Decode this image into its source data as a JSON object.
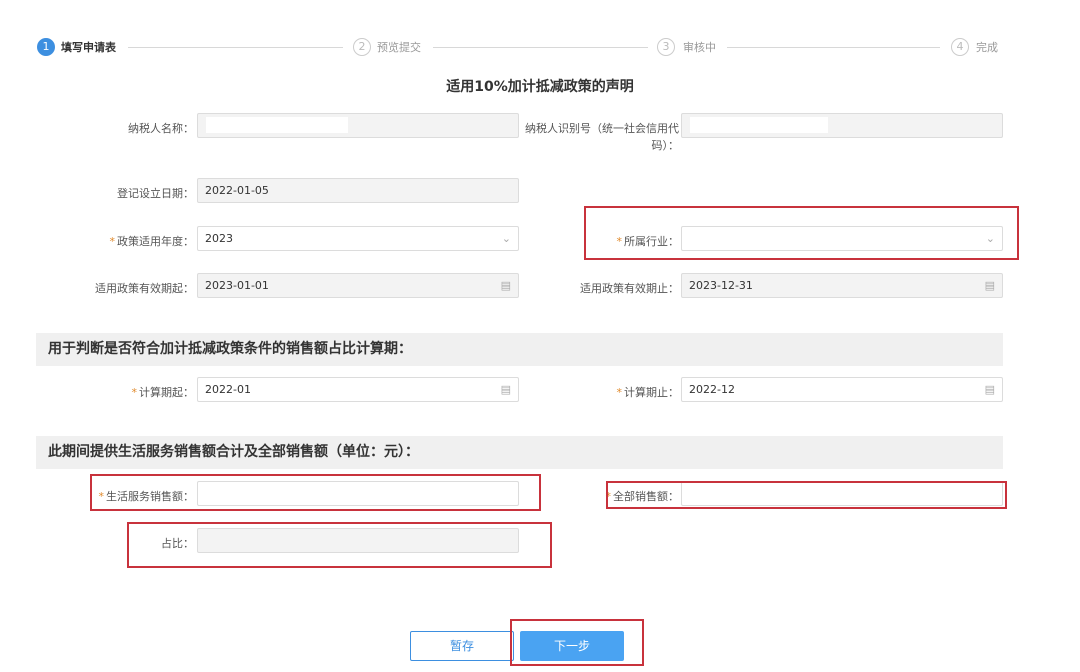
{
  "steps": [
    {
      "num": "1",
      "label": "填写申请表"
    },
    {
      "num": "2",
      "label": "预览提交"
    },
    {
      "num": "3",
      "label": "审核中"
    },
    {
      "num": "4",
      "label": "完成"
    }
  ],
  "form_title": "适用10%加计抵减政策的声明",
  "fields": {
    "taxpayer_name": {
      "label": "纳税人名称：",
      "value": ""
    },
    "taxpayer_id": {
      "label": "纳税人识别号（统一社会信用代码）：",
      "value": ""
    },
    "register_date": {
      "label": "登记设立日期：",
      "value": "2022-01-05"
    },
    "policy_year": {
      "label": "政策适用年度：",
      "value": "2023"
    },
    "industry": {
      "label": "所属行业：",
      "value": ""
    },
    "valid_from": {
      "label": "适用政策有效期起：",
      "value": "2023-01-01"
    },
    "valid_to": {
      "label": "适用政策有效期止：",
      "value": "2023-12-31"
    },
    "calc_from": {
      "label": "计算期起：",
      "value": "2022-01"
    },
    "calc_to": {
      "label": "计算期止：",
      "value": "2022-12"
    },
    "life_service_sales": {
      "label": "生活服务销售额：",
      "value": ""
    },
    "total_sales": {
      "label": "全部销售额：",
      "value": ""
    },
    "ratio": {
      "label": "占比：",
      "value": ""
    }
  },
  "sections": {
    "calc_period": "用于判断是否符合加计抵减政策条件的销售额占比计算期：",
    "sales": "此期间提供生活服务销售额合计及全部销售额（单位：元）："
  },
  "required_mark": "*",
  "buttons": {
    "save": "暂存",
    "next": "下一步"
  },
  "icons": {
    "dropdown": "chevron-down-icon",
    "calendar": "calendar-icon"
  },
  "colors": {
    "accent": "#3d8fe0",
    "required": "#e08a2c",
    "highlight_box": "#c8323c"
  }
}
